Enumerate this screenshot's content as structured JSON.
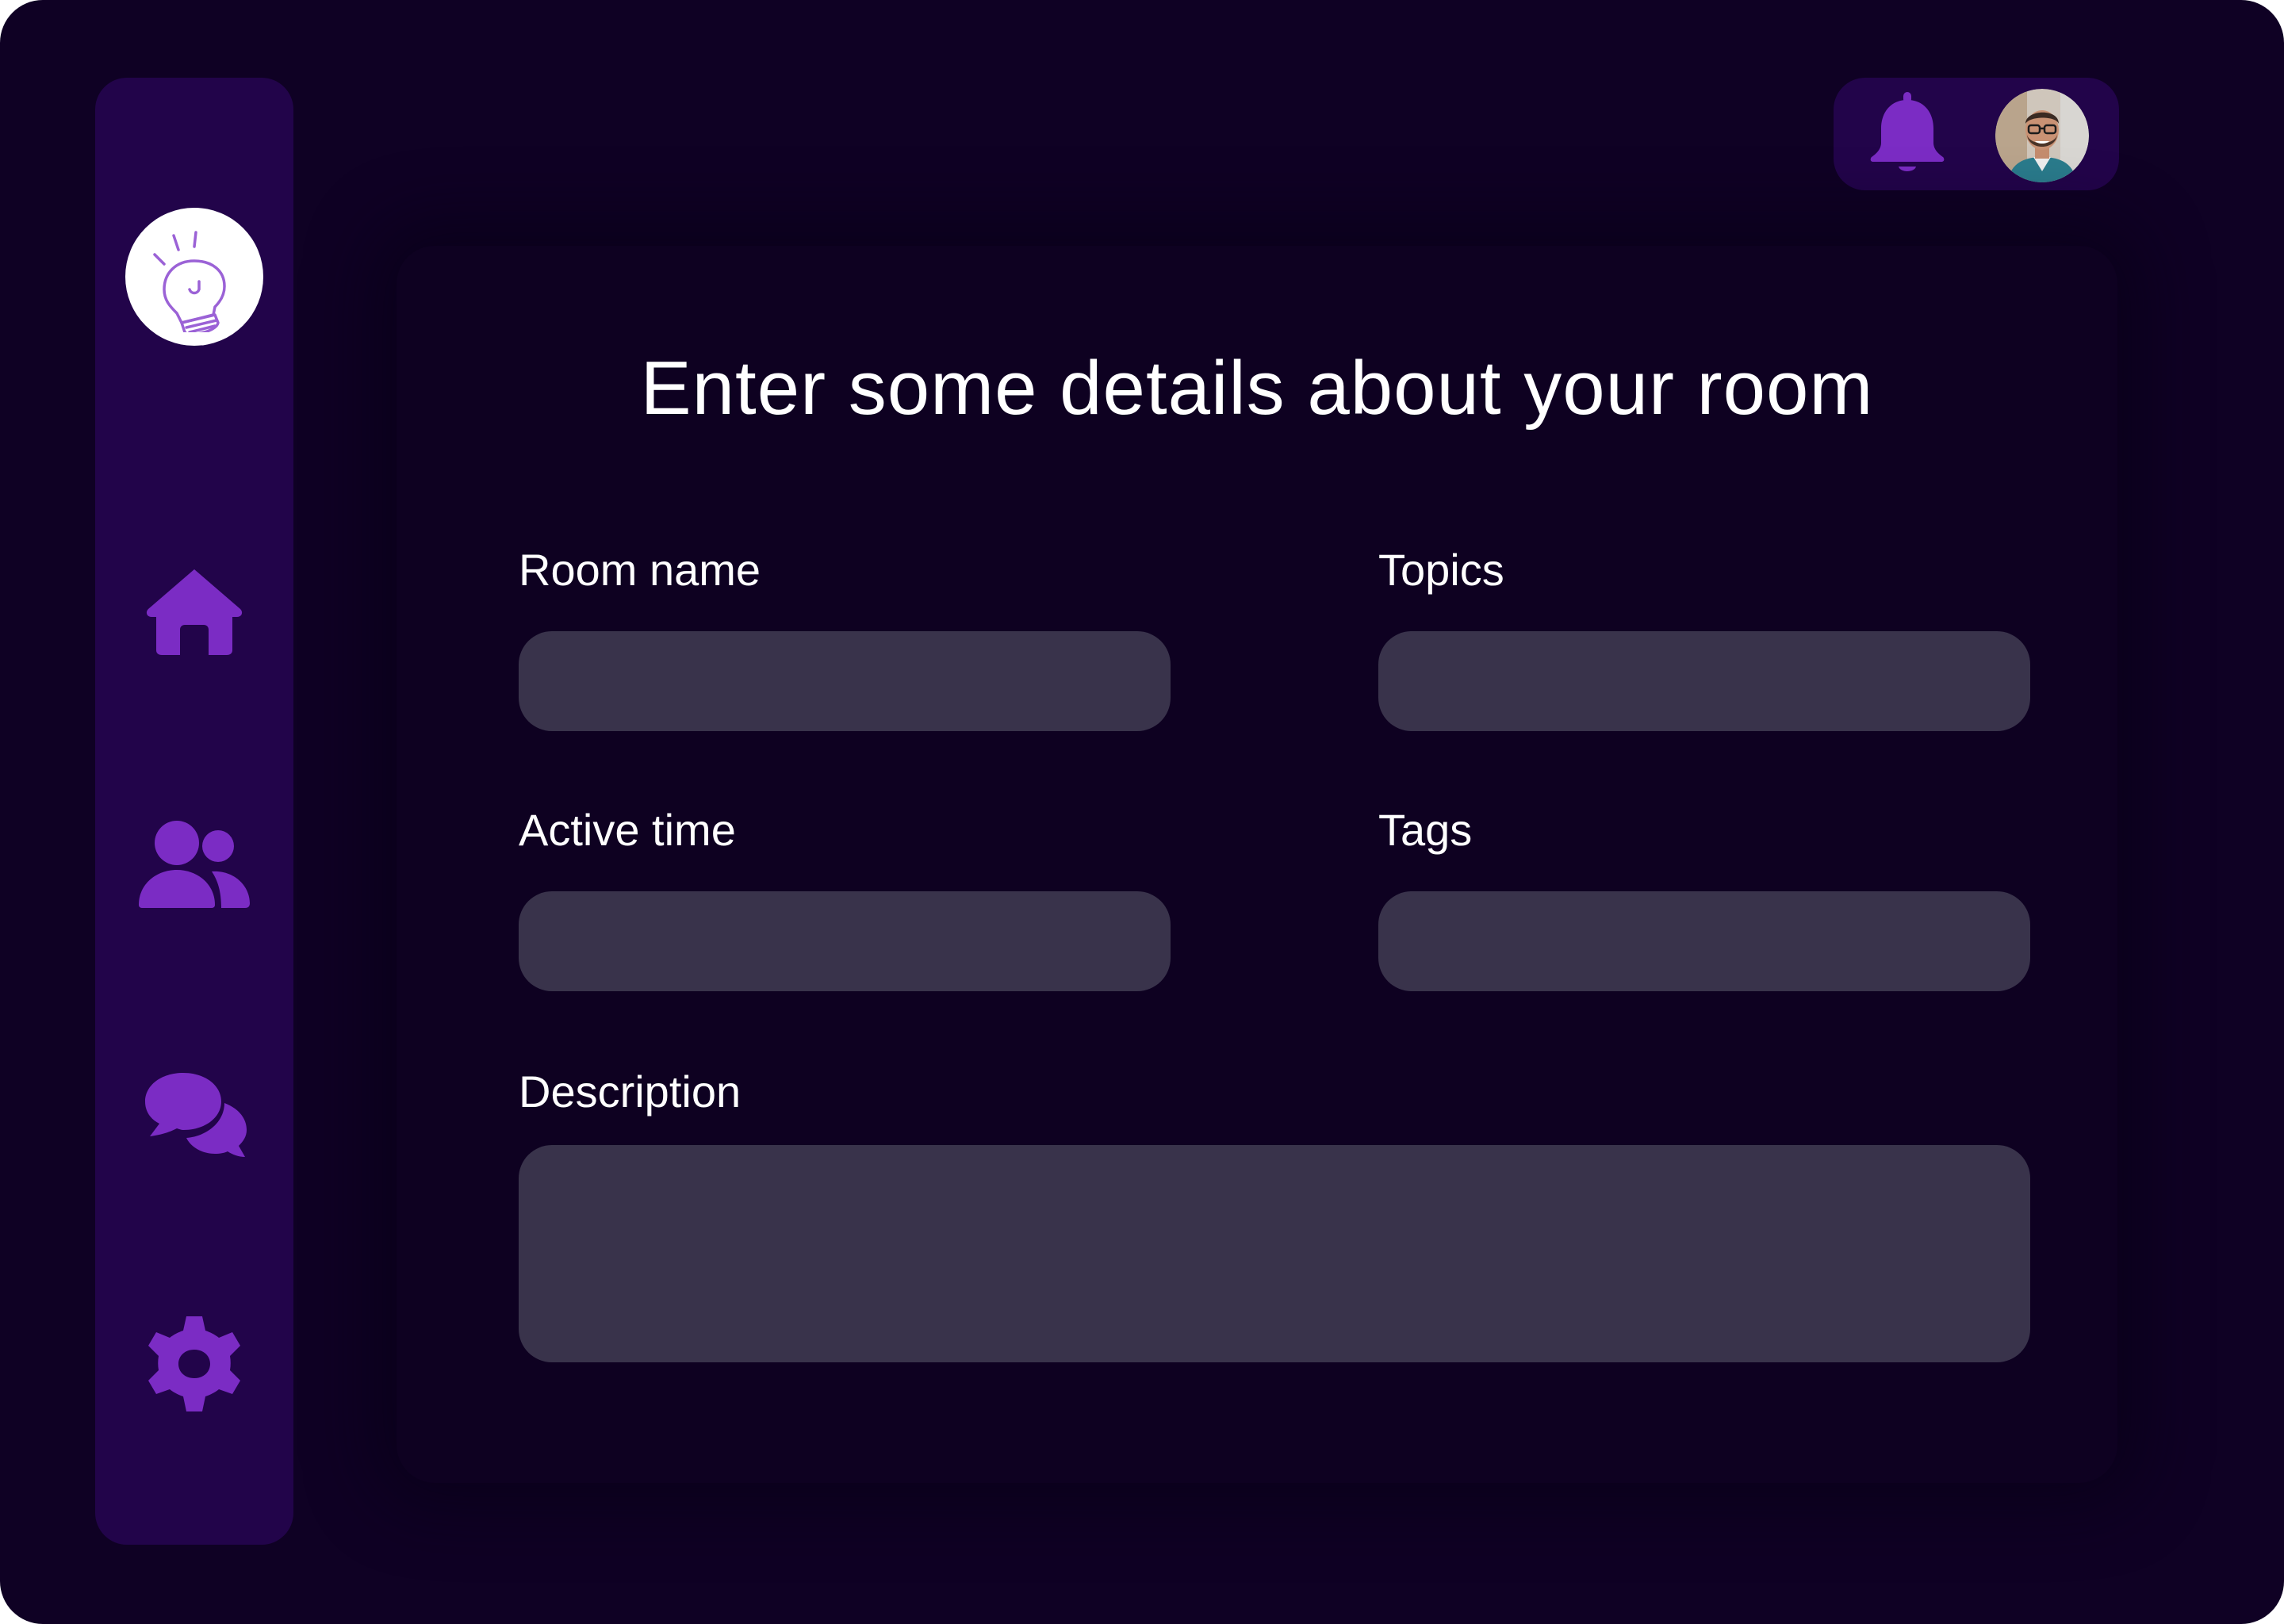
{
  "page": {
    "title": "Enter some details about your room"
  },
  "sidebar": {
    "logo_icon": "lightbulb-icon",
    "items": [
      {
        "id": "home",
        "icon": "home-icon"
      },
      {
        "id": "people",
        "icon": "users-icon"
      },
      {
        "id": "chat",
        "icon": "chat-bubbles-icon"
      },
      {
        "id": "settings",
        "icon": "gear-icon"
      }
    ]
  },
  "header": {
    "notification_icon": "bell-icon",
    "avatar": "user-avatar"
  },
  "form": {
    "room_name": {
      "label": "Room name",
      "value": ""
    },
    "topics": {
      "label": "Topics",
      "value": ""
    },
    "active_time": {
      "label": "Active time",
      "value": ""
    },
    "tags": {
      "label": "Tags",
      "value": ""
    },
    "description": {
      "label": "Description",
      "value": ""
    }
  },
  "colors": {
    "background": "#0f0124",
    "sidebar": "#22044a",
    "accent": "#7b2cc4",
    "field": "#39334b",
    "text": "#ffffff"
  }
}
